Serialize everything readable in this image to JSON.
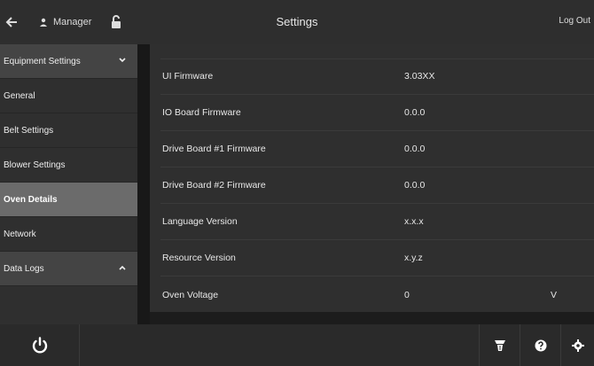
{
  "header": {
    "title": "Settings",
    "user_label": "Manager",
    "logout_label": "Log Out"
  },
  "sidebar": {
    "items": [
      {
        "label": "Equipment Settings",
        "type": "section",
        "expanded": true
      },
      {
        "label": "General"
      },
      {
        "label": "Belt Settings"
      },
      {
        "label": "Blower Settings"
      },
      {
        "label": "Oven Details",
        "selected": true
      },
      {
        "label": "Network"
      },
      {
        "label": "Data Logs",
        "type": "section",
        "expanded": false
      }
    ]
  },
  "details": {
    "rows": [
      {
        "label": "UI Firmware",
        "value": "3.03XX",
        "unit": ""
      },
      {
        "label": "IO Board Firmware",
        "value": "0.0.0",
        "unit": ""
      },
      {
        "label": "Drive Board #1 Firmware",
        "value": "0.0.0",
        "unit": ""
      },
      {
        "label": "Drive Board #2 Firmware",
        "value": "0.0.0",
        "unit": ""
      },
      {
        "label": "Language Version",
        "value": "x.x.x",
        "unit": ""
      },
      {
        "label": "Resource Version",
        "value": "x.y.z",
        "unit": ""
      },
      {
        "label": "Oven Voltage",
        "value": "0",
        "unit": "V"
      }
    ]
  },
  "footer": {
    "icons": [
      "power-icon",
      "cleaning-icon",
      "help-icon",
      "settings-icon"
    ]
  },
  "colors": {
    "background": "#1e1e1e",
    "panel": "#2f2f2f",
    "selected": "#6b6b6b",
    "section": "#444444"
  }
}
